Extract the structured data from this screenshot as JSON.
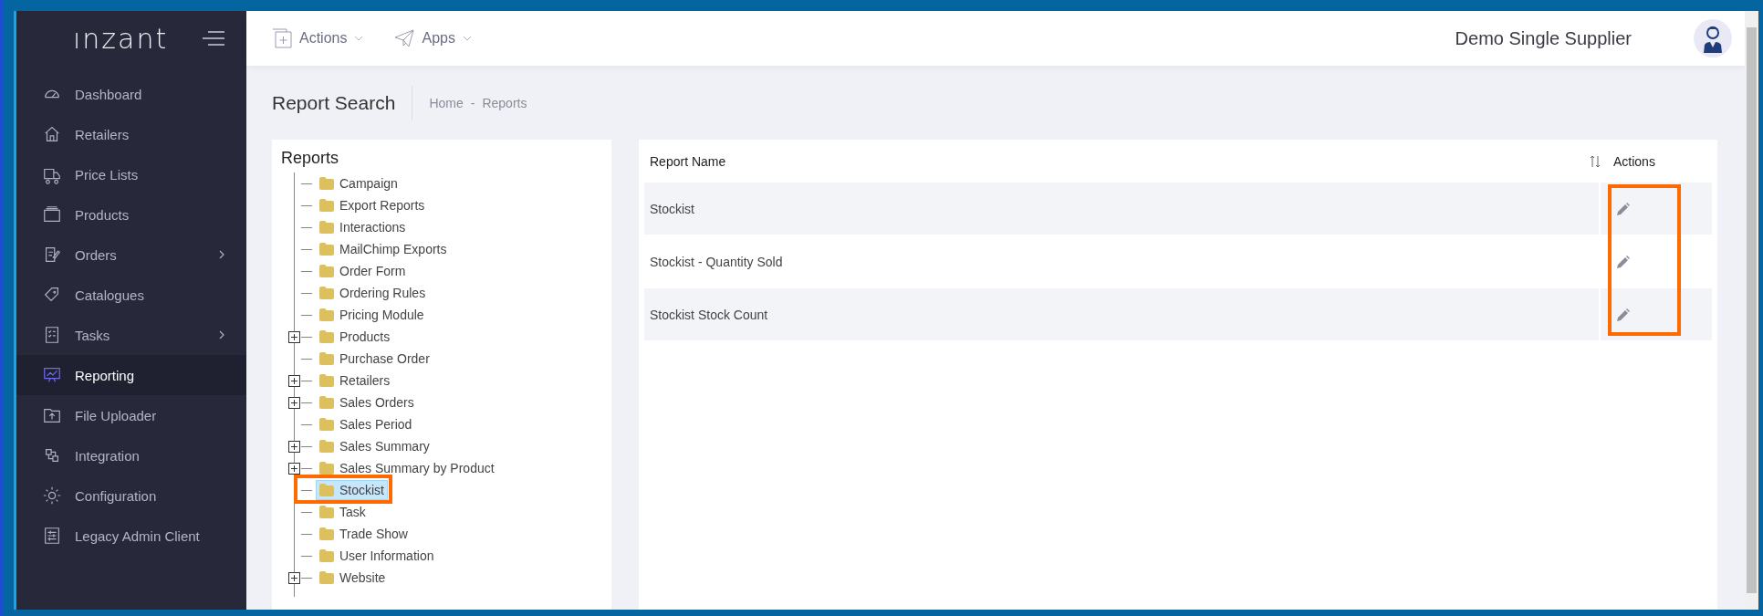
{
  "sidebar": {
    "logo": "ınzant",
    "items": [
      {
        "label": "Dashboard",
        "selected": false,
        "submenu": false
      },
      {
        "label": "Retailers",
        "selected": false,
        "submenu": false
      },
      {
        "label": "Price Lists",
        "selected": false,
        "submenu": false
      },
      {
        "label": "Products",
        "selected": false,
        "submenu": false
      },
      {
        "label": "Orders",
        "selected": false,
        "submenu": true
      },
      {
        "label": "Catalogues",
        "selected": false,
        "submenu": false
      },
      {
        "label": "Tasks",
        "selected": false,
        "submenu": true
      },
      {
        "label": "Reporting",
        "selected": true,
        "submenu": false
      },
      {
        "label": "File Uploader",
        "selected": false,
        "submenu": false
      },
      {
        "label": "Integration",
        "selected": false,
        "submenu": false
      },
      {
        "label": "Configuration",
        "selected": false,
        "submenu": false
      },
      {
        "label": "Legacy Admin Client",
        "selected": false,
        "submenu": false
      }
    ]
  },
  "header": {
    "menus": [
      "Actions",
      "Apps"
    ],
    "company": "Demo Single Supplier"
  },
  "page": {
    "title": "Report Search",
    "breadcrumb": [
      "Home",
      "Reports"
    ],
    "separator": "-"
  },
  "tree": {
    "title": "Reports",
    "items": [
      {
        "label": "Campaign",
        "expandable": false,
        "selected": false,
        "highlighted": false
      },
      {
        "label": "Export Reports",
        "expandable": false,
        "selected": false,
        "highlighted": false
      },
      {
        "label": "Interactions",
        "expandable": false,
        "selected": false,
        "highlighted": false
      },
      {
        "label": "MailChimp Exports",
        "expandable": false,
        "selected": false,
        "highlighted": false
      },
      {
        "label": "Order Form",
        "expandable": false,
        "selected": false,
        "highlighted": false
      },
      {
        "label": "Ordering Rules",
        "expandable": false,
        "selected": false,
        "highlighted": false
      },
      {
        "label": "Pricing Module",
        "expandable": false,
        "selected": false,
        "highlighted": false
      },
      {
        "label": "Products",
        "expandable": true,
        "selected": false,
        "highlighted": false
      },
      {
        "label": "Purchase Order",
        "expandable": false,
        "selected": false,
        "highlighted": false
      },
      {
        "label": "Retailers",
        "expandable": true,
        "selected": false,
        "highlighted": false
      },
      {
        "label": "Sales Orders",
        "expandable": true,
        "selected": false,
        "highlighted": false
      },
      {
        "label": "Sales Period",
        "expandable": false,
        "selected": false,
        "highlighted": false
      },
      {
        "label": "Sales Summary",
        "expandable": true,
        "selected": false,
        "highlighted": false
      },
      {
        "label": "Sales Summary by Product",
        "expandable": true,
        "selected": false,
        "highlighted": false
      },
      {
        "label": "Stockist",
        "expandable": false,
        "selected": true,
        "highlighted": true
      },
      {
        "label": "Task",
        "expandable": false,
        "selected": false,
        "highlighted": false
      },
      {
        "label": "Trade Show",
        "expandable": false,
        "selected": false,
        "highlighted": false
      },
      {
        "label": "User Information",
        "expandable": false,
        "selected": false,
        "highlighted": false
      },
      {
        "label": "Website",
        "expandable": true,
        "selected": false,
        "highlighted": false
      }
    ]
  },
  "table": {
    "columns": [
      "Report Name",
      "Actions"
    ],
    "actions_highlighted": true,
    "rows": [
      {
        "name": "Stockist"
      },
      {
        "name": "Stockist - Quantity Sold"
      },
      {
        "name": "Stockist Stock Count"
      }
    ]
  }
}
